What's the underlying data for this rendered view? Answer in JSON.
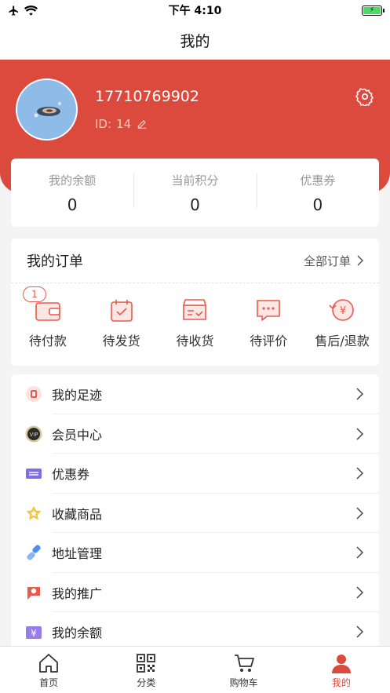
{
  "status_bar": {
    "time": "下午 4:10"
  },
  "nav": {
    "title": "我的"
  },
  "profile": {
    "phone": "17710769902",
    "id_label": "ID:",
    "id_value": "14"
  },
  "stats": [
    {
      "label": "我的余额",
      "value": "0"
    },
    {
      "label": "当前积分",
      "value": "0"
    },
    {
      "label": "优惠券",
      "value": "0"
    }
  ],
  "orders": {
    "title": "我的订单",
    "all_label": "全部订单",
    "items": [
      {
        "label": "待付款",
        "icon": "wallet-icon",
        "badge": "1"
      },
      {
        "label": "待发货",
        "icon": "calendar-check-icon"
      },
      {
        "label": "待收货",
        "icon": "box-icon"
      },
      {
        "label": "待评价",
        "icon": "comment-icon"
      },
      {
        "label": "售后/退款",
        "icon": "refund-icon"
      }
    ]
  },
  "menu": [
    {
      "label": "我的足迹",
      "icon": "footprint-icon"
    },
    {
      "label": "会员中心",
      "icon": "vip-icon"
    },
    {
      "label": "优惠券",
      "icon": "coupon-icon"
    },
    {
      "label": "收藏商品",
      "icon": "star-icon"
    },
    {
      "label": "地址管理",
      "icon": "link-icon"
    },
    {
      "label": "我的推广",
      "icon": "promotion-icon"
    },
    {
      "label": "我的余额",
      "icon": "balance-icon"
    }
  ],
  "tabs": [
    {
      "label": "首页",
      "icon": "home-icon"
    },
    {
      "label": "分类",
      "icon": "qrcode-icon"
    },
    {
      "label": "购物车",
      "icon": "cart-icon"
    },
    {
      "label": "我的",
      "icon": "user-icon",
      "active": true
    }
  ],
  "colors": {
    "accent": "#dc4a3d",
    "background": "#f4f4f4"
  }
}
